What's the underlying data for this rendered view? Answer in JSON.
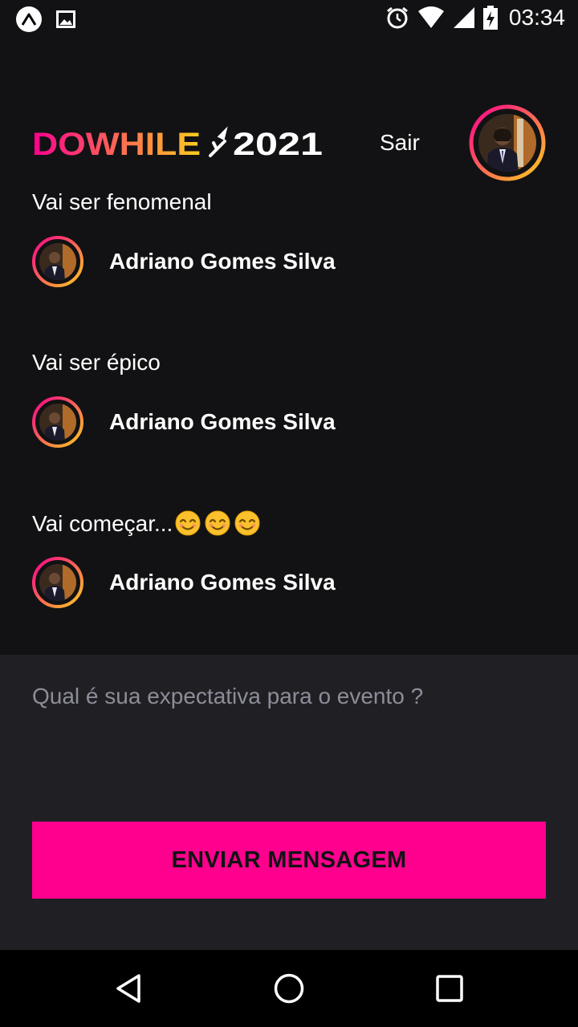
{
  "status_bar": {
    "time": "03:34",
    "icons": [
      "expo-app-icon",
      "image-icon",
      "alarm-icon",
      "wifi-icon",
      "signal-icon",
      "battery-charging-icon"
    ]
  },
  "header": {
    "logo_text": "DOWHILE 2021",
    "logout_label": "Sair"
  },
  "messages": [
    {
      "text": "Vai ser fenomenal",
      "emoji": "",
      "author": "Adriano Gomes Silva"
    },
    {
      "text": "Vai ser épico",
      "emoji": "",
      "author": "Adriano Gomes Silva"
    },
    {
      "text": "Vai começar...",
      "emoji": "😊😊😊",
      "author": "Adriano Gomes Silva"
    }
  ],
  "form": {
    "placeholder": "Qual é sua expectativa para o evento ?",
    "value": "",
    "send_label": "ENVIAR MENSAGEM"
  },
  "nav_bar": {
    "icons": [
      "back-icon",
      "home-icon",
      "recents-icon"
    ]
  },
  "colors": {
    "background": "#121214",
    "panel": "#202024",
    "accent_pink": "#ff008e",
    "gradient_orange": "#ffcd1e",
    "placeholder": "#8d8d99"
  }
}
